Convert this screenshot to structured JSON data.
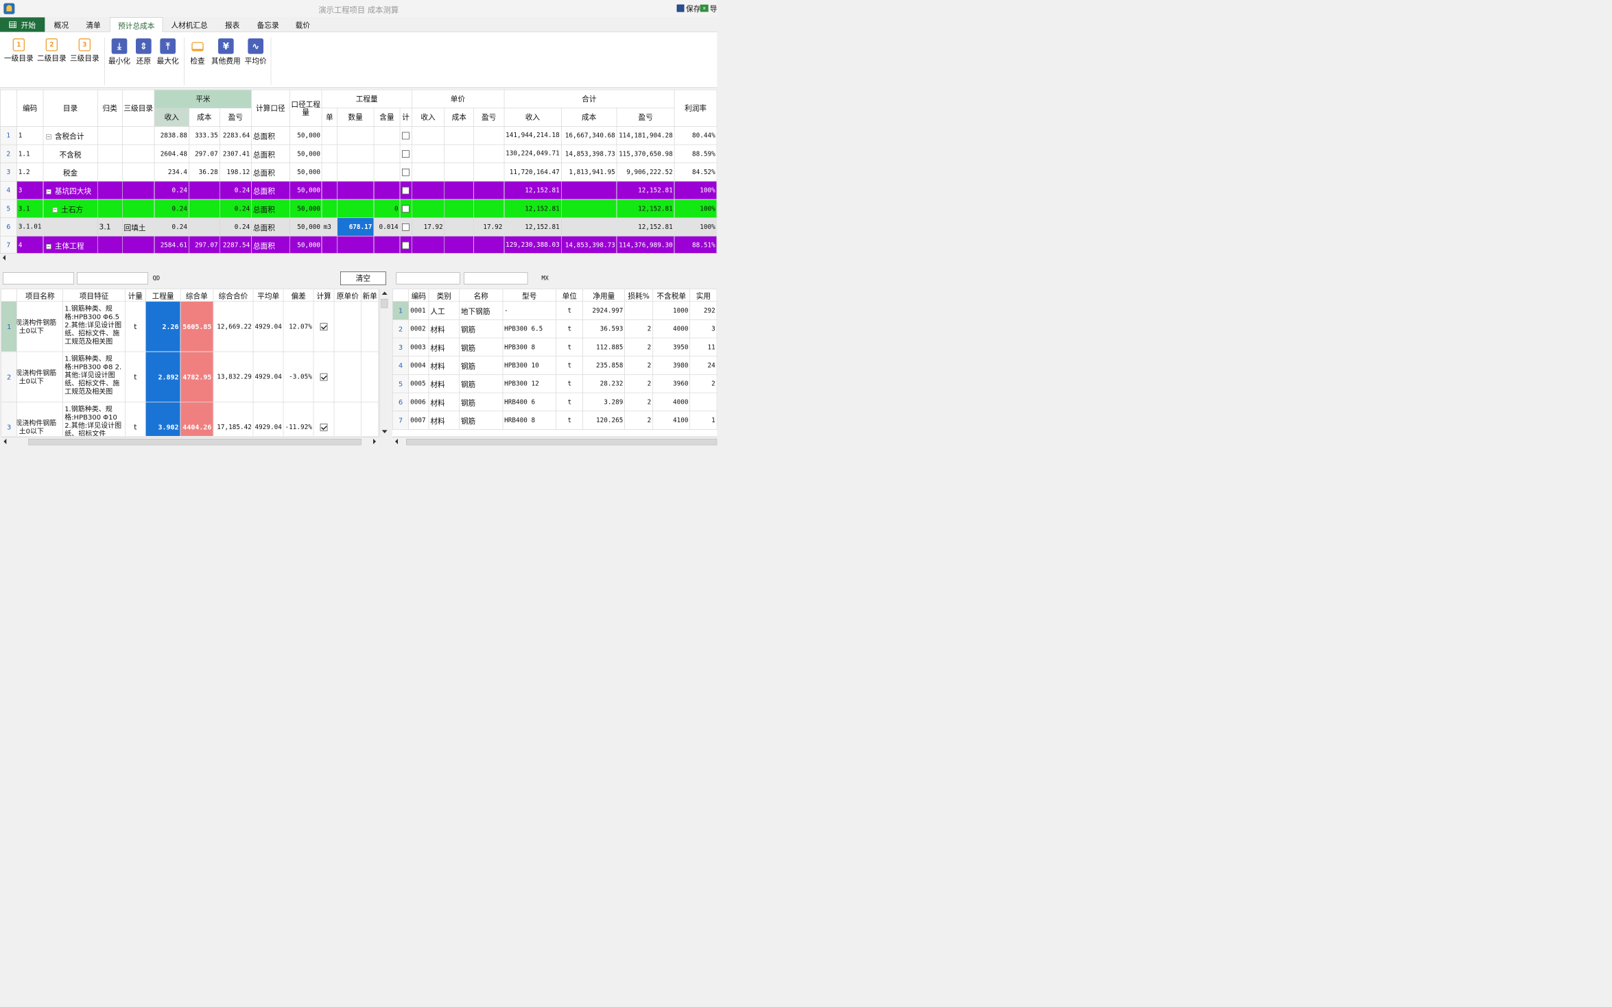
{
  "window": {
    "title": "演示工程项目 成本测算",
    "save_label": "保存",
    "export_label": "导"
  },
  "tabs": [
    {
      "label": "开始"
    },
    {
      "label": "概况"
    },
    {
      "label": "清单"
    },
    {
      "label": "预计总成本"
    },
    {
      "label": "人材机汇总"
    },
    {
      "label": "报表"
    },
    {
      "label": "备忘录"
    },
    {
      "label": "载价"
    }
  ],
  "ribbon": {
    "buttons": [
      {
        "label": "一级目录",
        "icon": "level1-icon",
        "glyph": "1"
      },
      {
        "label": "二级目录",
        "icon": "level2-icon",
        "glyph": "2"
      },
      {
        "label": "三级目录",
        "icon": "level3-icon",
        "glyph": "3"
      },
      {
        "label": "最小化",
        "icon": "minimize-icon",
        "glyph": "⤓"
      },
      {
        "label": "还原",
        "icon": "restore-icon",
        "glyph": "⇕"
      },
      {
        "label": "最大化",
        "icon": "maximize-icon",
        "glyph": "⤒"
      },
      {
        "label": "检查",
        "icon": "check-icon",
        "glyph": ""
      },
      {
        "label": "其他费用",
        "icon": "yen-icon",
        "glyph": "¥"
      },
      {
        "label": "平均价",
        "icon": "pulse-icon",
        "glyph": "∿"
      }
    ]
  },
  "upper_grid": {
    "headers": {
      "code": "编码",
      "catalog": "目录",
      "category": "归类",
      "level3": "三级目录",
      "pingmi": "平米",
      "income": "收入",
      "cost": "成本",
      "profit": "盈亏",
      "calc_basis": "计算口径",
      "basis_qty": "口径工程量",
      "quantity": "工程量",
      "unit": "单",
      "amount": "数量",
      "content": "含量",
      "calc": "计",
      "unit_price": "单价",
      "total": "合计",
      "profit_rate": "利润率"
    },
    "rows": [
      {
        "rn": "1",
        "code": "1",
        "name": "含税合计",
        "toggle": "−",
        "cat": "",
        "l3": "",
        "pm_in": "2838.88",
        "pm_cost": "333.35",
        "pm_pl": "2283.64",
        "basis": "总面积",
        "bqty": "50,000",
        "unit": "",
        "amount": "",
        "content": "",
        "up_in": "",
        "up_cost": "",
        "up_pl": "",
        "t_in": "141,944,214.18",
        "t_cost": "16,667,340.68",
        "t_pl": "114,181,904.28",
        "rate": "80.44%",
        "style": ""
      },
      {
        "rn": "2",
        "code": "1.1",
        "name": "不含税",
        "toggle": "",
        "cat": "",
        "l3": "",
        "pm_in": "2604.48",
        "pm_cost": "297.07",
        "pm_pl": "2307.41",
        "basis": "总面积",
        "bqty": "50,000",
        "unit": "",
        "amount": "",
        "content": "",
        "up_in": "",
        "up_cost": "",
        "up_pl": "",
        "t_in": "130,224,049.71",
        "t_cost": "14,853,398.73",
        "t_pl": "115,370,650.98",
        "rate": "88.59%",
        "style": ""
      },
      {
        "rn": "3",
        "code": "1.2",
        "name": "税金",
        "toggle": "",
        "cat": "",
        "l3": "",
        "pm_in": "234.4",
        "pm_cost": "36.28",
        "pm_pl": "198.12",
        "basis": "总面积",
        "bqty": "50,000",
        "unit": "",
        "amount": "",
        "content": "",
        "up_in": "",
        "up_cost": "",
        "up_pl": "",
        "t_in": "11,720,164.47",
        "t_cost": "1,813,941.95",
        "t_pl": "9,906,222.52",
        "rate": "84.52%",
        "style": ""
      },
      {
        "rn": "4",
        "code": "3",
        "name": "基坑四大块",
        "toggle": "−",
        "cat": "",
        "l3": "",
        "pm_in": "0.24",
        "pm_cost": "",
        "pm_pl": "0.24",
        "basis": "总面积",
        "bqty": "50,000",
        "unit": "",
        "amount": "",
        "content": "",
        "up_in": "",
        "up_cost": "",
        "up_pl": "",
        "t_in": "12,152.81",
        "t_cost": "",
        "t_pl": "12,152.81",
        "rate": "100%",
        "style": "purple"
      },
      {
        "rn": "5",
        "code": "3.1",
        "name": "土石方",
        "toggle": "−",
        "cat": "",
        "l3": "",
        "pm_in": "0.24",
        "pm_cost": "",
        "pm_pl": "0.24",
        "basis": "总面积",
        "bqty": "50,000",
        "unit": "",
        "amount": "",
        "content": "0",
        "up_in": "",
        "up_cost": "",
        "up_pl": "",
        "t_in": "12,152.81",
        "t_cost": "",
        "t_pl": "12,152.81",
        "rate": "100%",
        "style": "green"
      },
      {
        "rn": "6",
        "code": "3.1.01",
        "name": "",
        "toggle": "",
        "cat": "3.1",
        "l3": "回填土",
        "pm_in": "0.24",
        "pm_cost": "",
        "pm_pl": "0.24",
        "basis": "总面积",
        "bqty": "50,000",
        "unit": "m3",
        "amount": "678.17",
        "content": "0.014",
        "up_in": "17.92",
        "up_cost": "",
        "up_pl": "17.92",
        "t_in": "12,152.81",
        "t_cost": "",
        "t_pl": "12,152.81",
        "rate": "100%",
        "style": "gray"
      },
      {
        "rn": "7",
        "code": "4",
        "name": "主体工程",
        "toggle": "−",
        "cat": "",
        "l3": "",
        "pm_in": "2584.61",
        "pm_cost": "297.07",
        "pm_pl": "2287.54",
        "basis": "总面积",
        "bqty": "50,000",
        "unit": "",
        "amount": "",
        "content": "",
        "up_in": "",
        "up_cost": "",
        "up_pl": "",
        "t_in": "129,230,388.03",
        "t_cost": "14,853,398.73",
        "t_pl": "114,376,989.30",
        "rate": "88.51%",
        "style": "purple"
      }
    ]
  },
  "filter": {
    "qd_label": "QD",
    "clear_label": "清空",
    "mx_label": "MX"
  },
  "left_grid": {
    "headers": [
      "项目名称",
      "项目特征",
      "计量",
      "工程量",
      "综合单",
      "综合合价",
      "平均单",
      "偏差",
      "计算",
      "原单价",
      "新单"
    ],
    "rows": [
      {
        "rn": "1",
        "name": "现浇构件钢筋 土0以下",
        "feat": "1.钢筋种类、规格:HPB300 Φ6.5 2.其他:详见设计图纸、招标文件、施工规范及相关图",
        "unit": "t",
        "qty": "2.26",
        "rate": "5605.85",
        "total": "12,669.22",
        "avg": "4929.04",
        "dev": "12.07%",
        "checked": true
      },
      {
        "rn": "2",
        "name": "现浇构件钢筋 土0以下",
        "feat": "1.钢筋种类、规格:HPB300 Φ8 2.其他:详见设计图纸、招标文件、施工规范及相关图",
        "unit": "t",
        "qty": "2.892",
        "rate": "4782.95",
        "total": "13,832.29",
        "avg": "4929.04",
        "dev": "-3.05%",
        "checked": true
      },
      {
        "rn": "3",
        "name": "现浇构件钢筋 土0以下",
        "feat": "1.钢筋种类、规格:HPB300 Φ10 2.其他:详见设计图纸、招标文件",
        "unit": "t",
        "qty": "3.902",
        "rate": "4404.26",
        "total": "17,185.42",
        "avg": "4929.04",
        "dev": "-11.92%",
        "checked": true
      }
    ]
  },
  "right_grid": {
    "headers": [
      "编码",
      "类别",
      "名称",
      "型号",
      "单位",
      "净用量",
      "损耗%",
      "不含税单",
      "实用"
    ],
    "rows": [
      {
        "rn": "1",
        "code": "0001",
        "type": "人工",
        "name": "地下钢筋",
        "model": "-",
        "unit": "t",
        "net": "2924.997",
        "loss": "",
        "price": "1000",
        "used": "292"
      },
      {
        "rn": "2",
        "code": "0002",
        "type": "材料",
        "name": "钢筋",
        "model": "HPB300 6.5",
        "unit": "t",
        "net": "36.593",
        "loss": "2",
        "price": "4000",
        "used": "3"
      },
      {
        "rn": "3",
        "code": "0003",
        "type": "材料",
        "name": "钢筋",
        "model": "HPB300 8",
        "unit": "t",
        "net": "112.885",
        "loss": "2",
        "price": "3950",
        "used": "11"
      },
      {
        "rn": "4",
        "code": "0004",
        "type": "材料",
        "name": "钢筋",
        "model": "HPB300 10",
        "unit": "t",
        "net": "235.858",
        "loss": "2",
        "price": "3980",
        "used": "24"
      },
      {
        "rn": "5",
        "code": "0005",
        "type": "材料",
        "name": "钢筋",
        "model": "HPB300 12",
        "unit": "t",
        "net": "28.232",
        "loss": "2",
        "price": "3960",
        "used": "2"
      },
      {
        "rn": "6",
        "code": "0006",
        "type": "材料",
        "name": "钢筋",
        "model": "HRB400 6",
        "unit": "t",
        "net": "3.289",
        "loss": "2",
        "price": "4000",
        "used": ""
      },
      {
        "rn": "7",
        "code": "0007",
        "type": "材料",
        "name": "钢筋",
        "model": "HRB400 8",
        "unit": "t",
        "net": "120.265",
        "loss": "2",
        "price": "4100",
        "used": "1"
      }
    ]
  },
  "colors": {
    "accent_green": "#1f6e3b",
    "row_purple": "#9b00d4",
    "row_green": "#12e812",
    "qty_blue": "#1a74d6",
    "rate_red": "#f08080"
  }
}
